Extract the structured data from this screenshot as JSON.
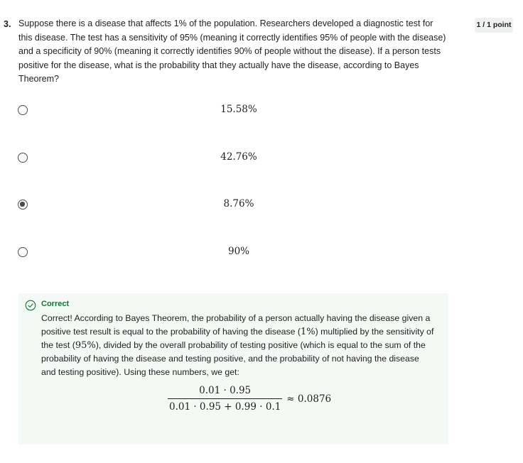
{
  "question": {
    "number": "3.",
    "text": "Suppose there is a disease that affects 1% of the population. Researchers developed a diagnostic test for this disease. The test has a sensitivity of 95% (meaning it correctly identifies 95% of people with the disease) and a specificity of 90% (meaning it correctly identifies 90% of people without the disease). If a person tests positive for the disease, what is the probability that they actually have the disease, according to Bayes Theorem?",
    "points": "1 / 1 point"
  },
  "options": [
    {
      "label": "15.58%",
      "selected": false
    },
    {
      "label": "42.76%",
      "selected": false
    },
    {
      "label": "8.76%",
      "selected": true
    },
    {
      "label": "90%",
      "selected": false
    }
  ],
  "feedback": {
    "status": "Correct",
    "status_color": "#137333",
    "icon": "check-circle-icon",
    "text_part1": "Correct!  According to Bayes Theorem, the probability of a person actually having the disease given a positive test result is equal to the probability of having the disease (",
    "math1": "1%",
    "text_part2": ") multiplied by the sensitivity of the test (",
    "math2": "95%",
    "text_part3": "), divided by the overall probability of testing positive (which is equal to the sum of the probability of having the disease and testing positive, and the probability of not having the disease and testing positive). Using these numbers, we get:",
    "formula_numerator": "0.01 · 0.95",
    "formula_denominator": "0.01 · 0.95 + 0.99 · 0.1",
    "formula_result": "≈ 0.0876"
  }
}
